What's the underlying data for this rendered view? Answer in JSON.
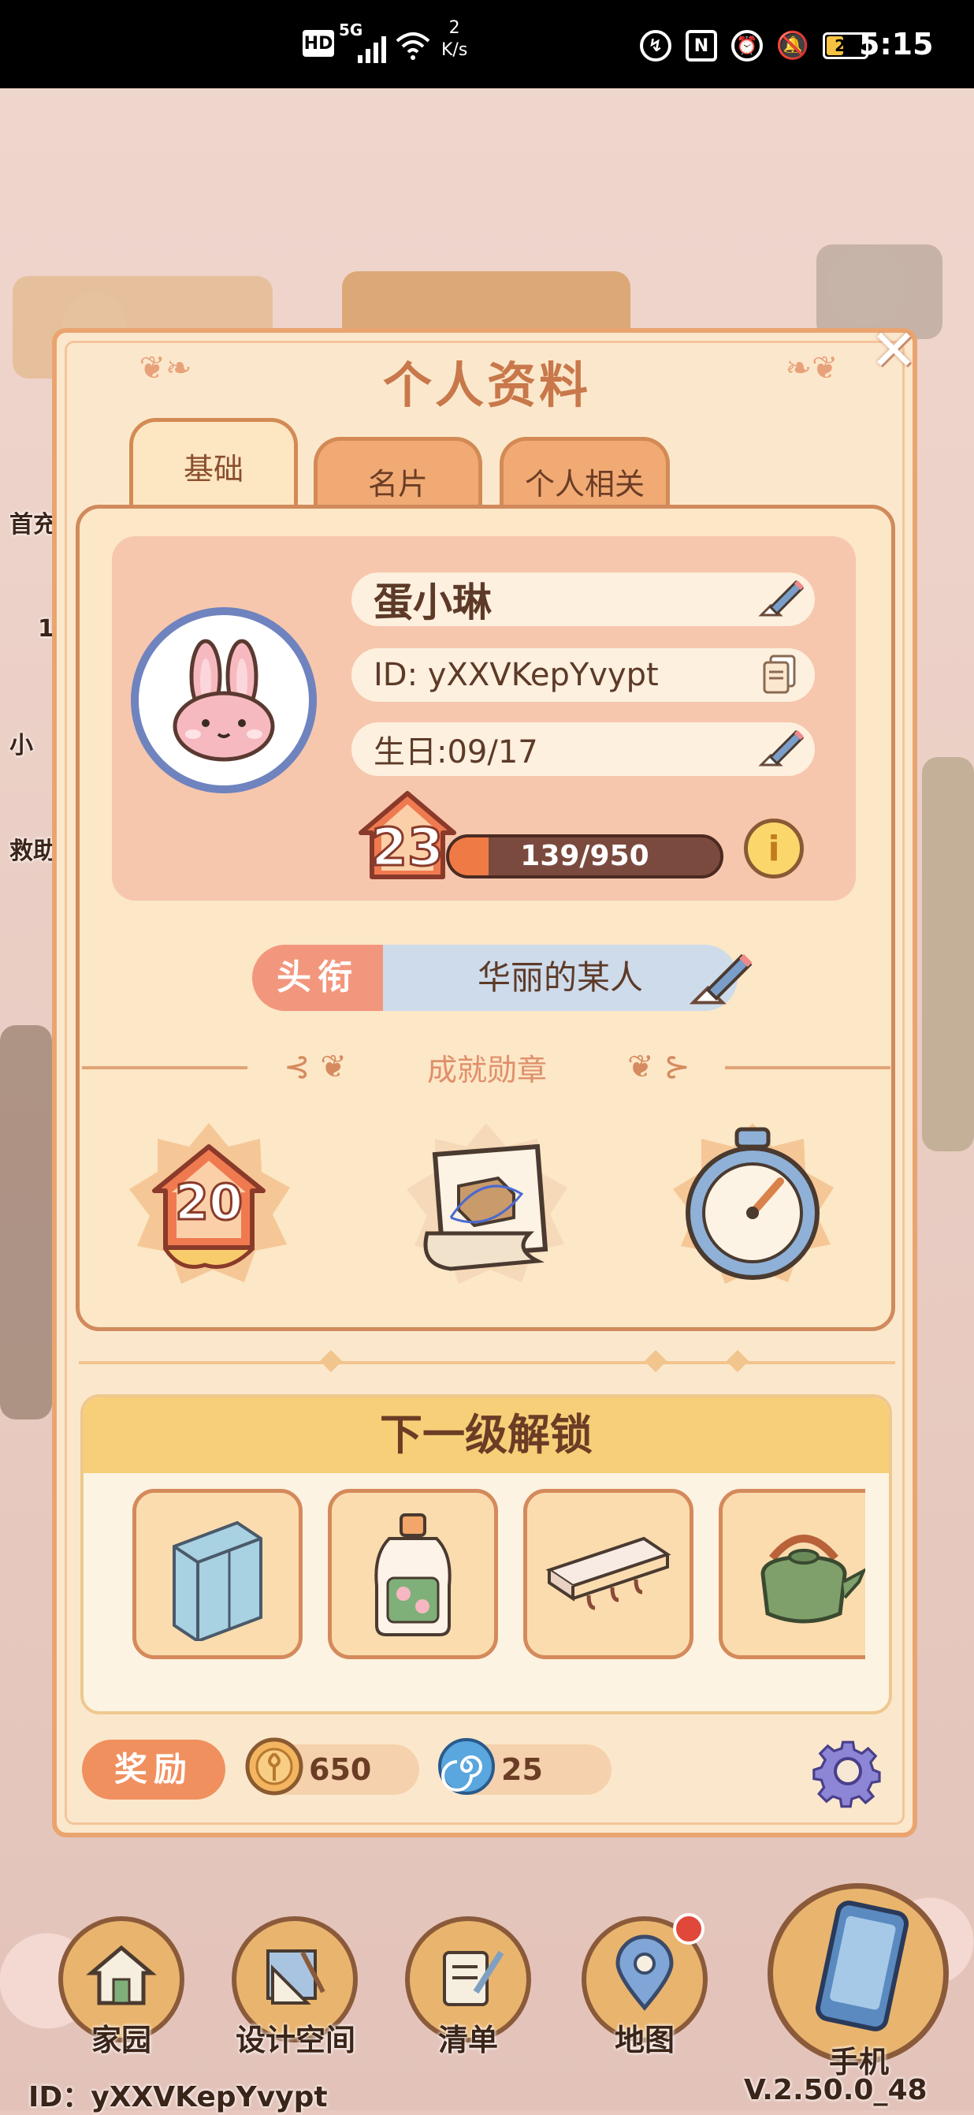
{
  "status_bar": {
    "network": "5G",
    "hd_label": "HD",
    "speed_value": "2",
    "speed_unit": "K/s",
    "battery": "20",
    "time": "5:15"
  },
  "panel": {
    "title": "个人资料",
    "tabs": [
      {
        "label": "基础",
        "active": true
      },
      {
        "label": "名片",
        "active": false
      },
      {
        "label": "个人相关",
        "active": false
      }
    ]
  },
  "profile": {
    "name": "蛋小琳",
    "id": "ID: yXXVKepYvypt",
    "birthday": "生日:09/17",
    "level": "23",
    "xp_text": "139/950",
    "xp_progress": 0.146
  },
  "player_title": {
    "label": "头衔",
    "value": "华丽的某人"
  },
  "achievements": {
    "header": "成就勋章",
    "medal_1_number": "20"
  },
  "unlock": {
    "header": "下一级解锁",
    "items": [
      "cabinet-icon",
      "detergent-bottle-icon",
      "wall-shelf-icon",
      "kettle-icon"
    ]
  },
  "rewards": {
    "label": "奖励",
    "coins": "650",
    "gems": "25"
  },
  "bottom_nav": {
    "items": [
      {
        "label": "家园"
      },
      {
        "label": "设计空间"
      },
      {
        "label": "清单"
      },
      {
        "label": "地图"
      },
      {
        "label": "手机"
      }
    ]
  },
  "footer": {
    "id": "ID：yXXVKepYvypt",
    "version": "V.2.50.0_48"
  },
  "side_labels": [
    "首充",
    "1",
    "小",
    "救助"
  ],
  "colors": {
    "panel_bg": "#fbe8cc",
    "panel_border": "#eaa46f",
    "title_text": "#c8784a",
    "tab_inactive": "#f1aa74",
    "xp_fill": "#f07a45",
    "title_label_bg": "#f2977d",
    "title_value_bg": "#cedbea",
    "unlock_header_bg": "#f7cf78"
  }
}
